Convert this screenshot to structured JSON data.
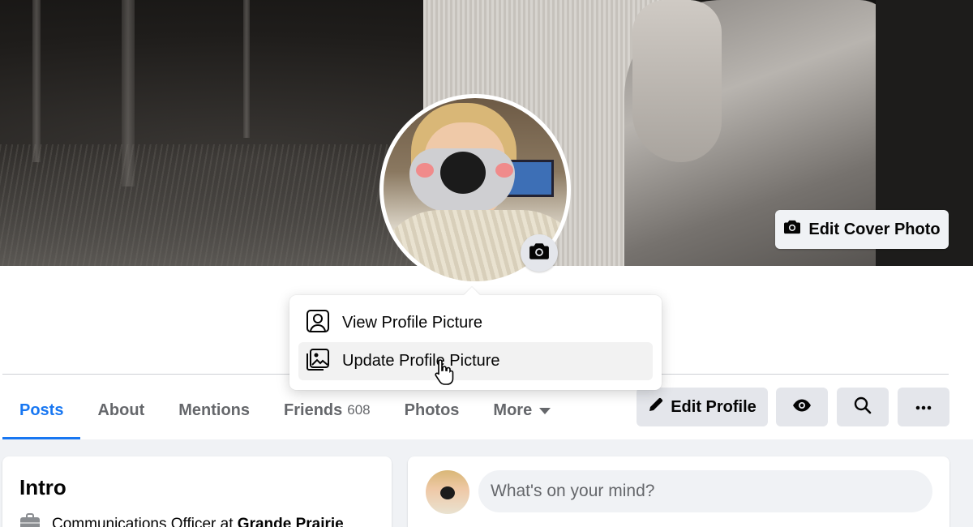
{
  "cover": {
    "edit_cover_label": "Edit Cover Photo"
  },
  "profile_menu": {
    "items": [
      {
        "label": "View Profile Picture",
        "icon": "person-frame-icon"
      },
      {
        "label": "Update Profile Picture",
        "icon": "image-frame-icon"
      }
    ]
  },
  "tabs": {
    "posts": "Posts",
    "about": "About",
    "mentions": "Mentions",
    "friends": "Friends",
    "friends_count": "608",
    "photos": "Photos",
    "more": "More"
  },
  "actions": {
    "edit_profile": "Edit Profile"
  },
  "intro": {
    "title": "Intro",
    "work_prefix": "Communications Officer at ",
    "work_org": "Grande Prairie"
  },
  "composer": {
    "placeholder": "What's on your mind?"
  },
  "colors": {
    "accent": "#1877f2",
    "button_bg": "#e4e6eb",
    "page_bg": "#f0f2f5"
  }
}
